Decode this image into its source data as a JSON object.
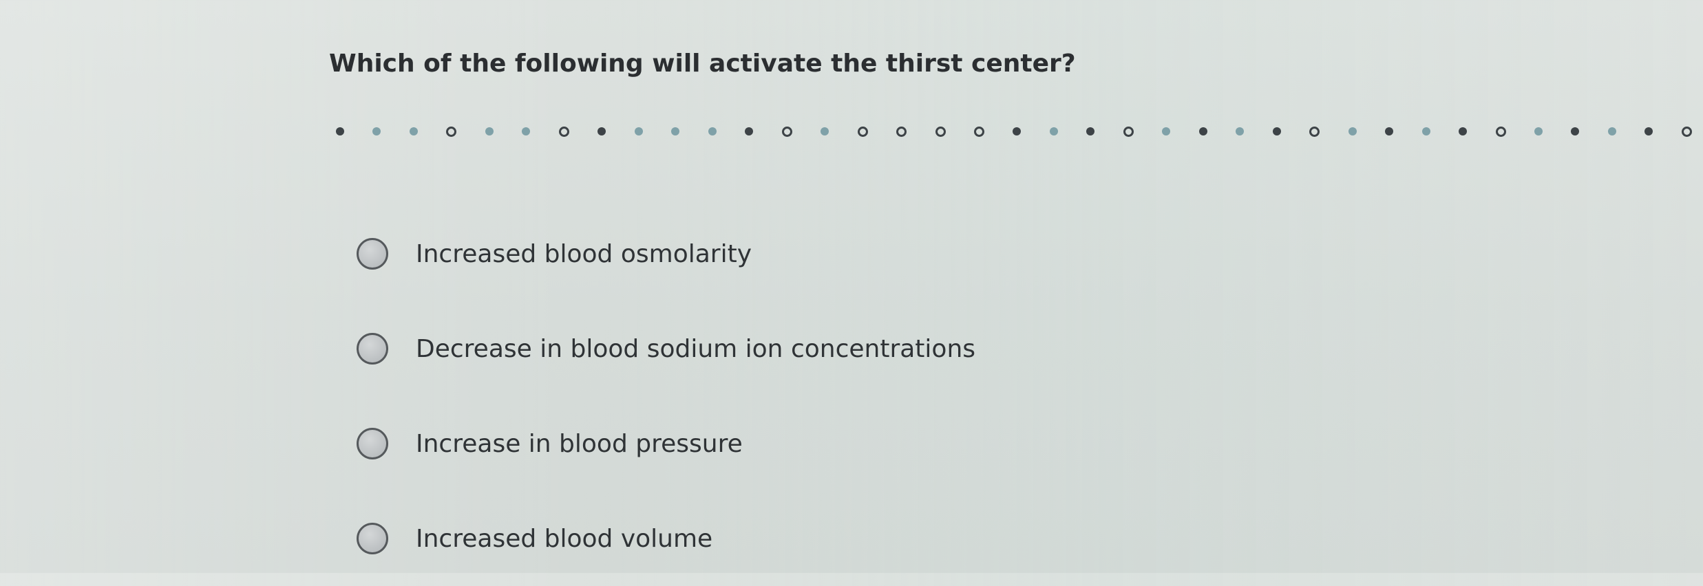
{
  "question": {
    "text": "Which of the following will activate the thirst center?"
  },
  "options": [
    {
      "label": "Increased blood osmolarity"
    },
    {
      "label": "Decrease in blood sodium ion concentrations"
    },
    {
      "label": "Increase in blood pressure"
    },
    {
      "label": "Increased blood volume"
    }
  ],
  "colors": {
    "background": "#d8dedb",
    "text": "#2f3336",
    "dot_dark": "#3d4347",
    "dot_light": "#7fa1a8"
  }
}
